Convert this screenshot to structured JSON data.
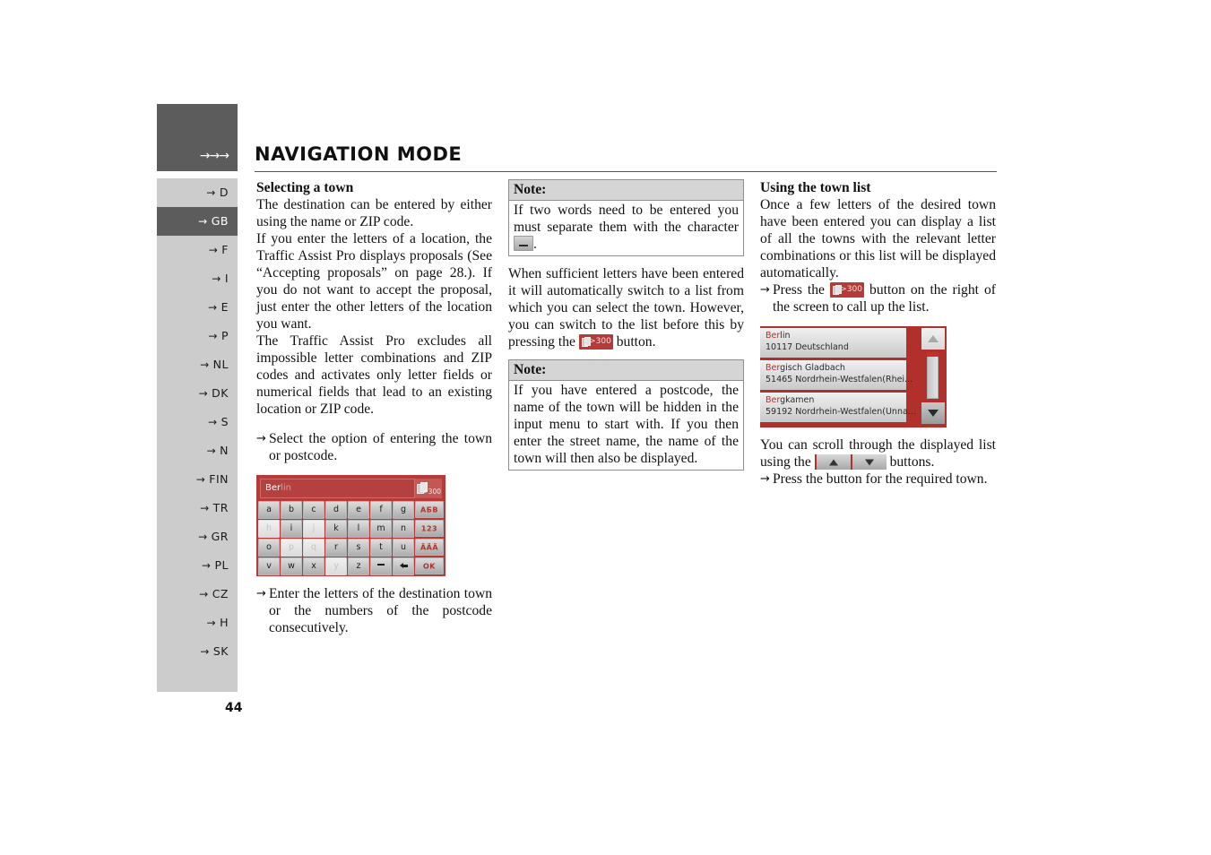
{
  "header": {
    "arrows": "→→→",
    "title": "NAVIGATION MODE"
  },
  "page_number": "44",
  "sidebar": {
    "items": [
      {
        "label": "D",
        "active": false
      },
      {
        "label": "GB",
        "active": true
      },
      {
        "label": "F",
        "active": false
      },
      {
        "label": "I",
        "active": false
      },
      {
        "label": "E",
        "active": false
      },
      {
        "label": "P",
        "active": false
      },
      {
        "label": "NL",
        "active": false
      },
      {
        "label": "DK",
        "active": false
      },
      {
        "label": "S",
        "active": false
      },
      {
        "label": "N",
        "active": false
      },
      {
        "label": "FIN",
        "active": false
      },
      {
        "label": "TR",
        "active": false
      },
      {
        "label": "GR",
        "active": false
      },
      {
        "label": "PL",
        "active": false
      },
      {
        "label": "CZ",
        "active": false
      },
      {
        "label": "H",
        "active": false
      },
      {
        "label": "SK",
        "active": false
      }
    ]
  },
  "column1": {
    "heading": "Selecting a town",
    "para1": "The destination can be entered by either using the name or ZIP code.",
    "para2": "If you enter the letters of a location, the Traffic Assist Pro displays proposals (See “Accepting proposals” on page 28.). If you do not want to accept the proposal, just enter the other letters of the location you want.",
    "para3": "The Traffic Assist Pro excludes all impossible letter combinations and ZIP codes and activates only letter fields or numerical fields that lead to an existing location or ZIP code.",
    "bullet1_arrow": "→",
    "bullet1": "Select the option of entering the town or postcode.",
    "bullet2_arrow": "→",
    "bullet2": "Enter the letters of the destination town or the numbers of the postcode consecutively."
  },
  "keyboard_figure": {
    "input_typed": "Ber",
    "input_suggestion": "lin",
    "list_button_label": ">300",
    "rows": [
      [
        {
          "label": "a",
          "disabled": false
        },
        {
          "label": "b",
          "disabled": false
        },
        {
          "label": "c",
          "disabled": false
        },
        {
          "label": "d",
          "disabled": false
        },
        {
          "label": "e",
          "disabled": false
        },
        {
          "label": "f",
          "disabled": false
        },
        {
          "label": "g",
          "disabled": false
        }
      ],
      [
        {
          "label": "h",
          "disabled": true
        },
        {
          "label": "i",
          "disabled": false
        },
        {
          "label": "j",
          "disabled": true
        },
        {
          "label": "k",
          "disabled": false
        },
        {
          "label": "l",
          "disabled": false
        },
        {
          "label": "m",
          "disabled": false
        },
        {
          "label": "n",
          "disabled": false
        }
      ],
      [
        {
          "label": "o",
          "disabled": false
        },
        {
          "label": "p",
          "disabled": true
        },
        {
          "label": "q",
          "disabled": true
        },
        {
          "label": "r",
          "disabled": false
        },
        {
          "label": "s",
          "disabled": false
        },
        {
          "label": "t",
          "disabled": false
        },
        {
          "label": "u",
          "disabled": false
        }
      ],
      [
        {
          "label": "v",
          "disabled": false
        },
        {
          "label": "w",
          "disabled": false
        },
        {
          "label": "x",
          "disabled": false
        },
        {
          "label": "y",
          "disabled": true
        },
        {
          "label": "z",
          "disabled": false
        },
        {
          "label": "_",
          "disabled": false,
          "icon": "underscore-key"
        },
        {
          "label": "⌫",
          "disabled": false,
          "icon": "backspace-key"
        }
      ]
    ],
    "side_keys": [
      "АБВ",
      "123",
      "ÄÄÄ",
      "OK"
    ]
  },
  "column2": {
    "note1_title": "Note:",
    "note1_text_before": "If two words need to be entered you must separate them with the character",
    "note1_text_after": ".",
    "para1_before": "When sufficient letters have been entered it will automatically switch to a list from which you can select the town. However, you can switch to the list before this by pressing the",
    "para1_button": ">300",
    "para1_after": "button.",
    "note2_title": "Note:",
    "note2_text": "If you have entered a postcode, the name of the town will be hidden in the input menu to start with. If you then enter the street name, the name of the town will then also be displayed."
  },
  "column3": {
    "heading": "Using the town list",
    "para1": "Once a few letters of the desired town have been entered you can display a list of all the towns with the relevant letter combinations or this list will be displayed automatically.",
    "bullet1_arrow": "→",
    "bullet1_before": "Press the",
    "bullet1_button": ">300",
    "bullet1_after": "button on the right of the screen to call up the list.",
    "para2_before": "You can scroll through the displayed list using the",
    "para2_after": "buttons.",
    "bullet2_arrow": "→",
    "bullet2": "Press the button for the required town."
  },
  "town_list_figure": {
    "items": [
      {
        "highlight": "Ber",
        "rest": "lin",
        "sub": "10117 Deutschland"
      },
      {
        "highlight": "Ber",
        "rest": "gisch Gladbach",
        "sub": "51465 Nordrhein-Westfalen(Rhei..."
      },
      {
        "highlight": "Ber",
        "rest": "gkamen",
        "sub": "59192 Nordrhein-Westfalen(Unna..."
      }
    ]
  },
  "colors": {
    "device_red": "#b2302c",
    "sidebar_active": "#5c5c5c",
    "sidebar_bg": "#cccccc"
  }
}
